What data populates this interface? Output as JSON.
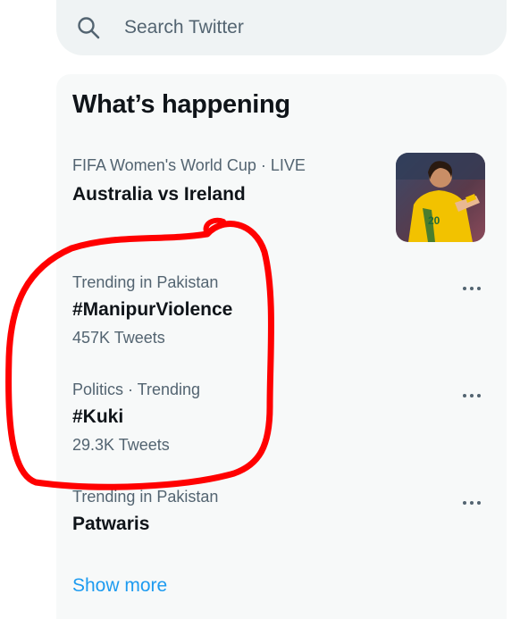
{
  "search": {
    "placeholder": "Search Twitter"
  },
  "panel": {
    "title": "What’s happening",
    "show_more": "Show more",
    "trends": [
      {
        "meta": "FIFA Women's World Cup · LIVE",
        "name": "Australia vs Ireland",
        "count": ""
      },
      {
        "meta": "Trending in Pakistan",
        "name": "#ManipurViolence",
        "count": "457K Tweets"
      },
      {
        "meta": "Politics · Trending",
        "name": "#Kuki",
        "count": "29.3K Tweets"
      },
      {
        "meta": "Trending in Pakistan",
        "name": "Patwaris",
        "count": ""
      }
    ]
  },
  "colors": {
    "accent": "#1d9bf0",
    "annotation": "#ff0000",
    "panel_bg": "#f7f9f9",
    "search_bg": "#eff3f4",
    "secondary_text": "#536471"
  },
  "icons": {
    "search": "search-icon",
    "more": "more-horizontal-icon"
  }
}
